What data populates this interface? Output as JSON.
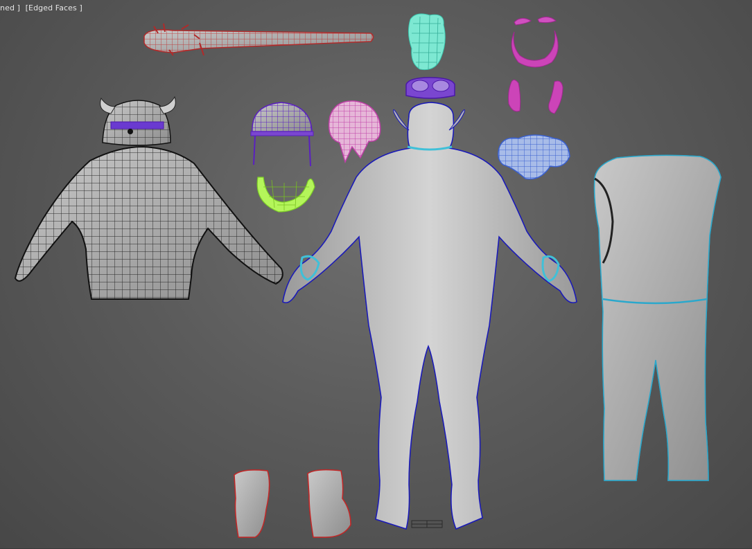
{
  "viewport": {
    "labels": [
      "ned ]",
      "[Edged Faces ]"
    ]
  },
  "objects": [
    {
      "name": "spiked-bat",
      "color": "#d04040"
    },
    {
      "name": "hair-tuft",
      "color": "#6fe0c8"
    },
    {
      "name": "eyebrows",
      "color": "#c43fb0"
    },
    {
      "name": "goggles",
      "color": "#6a2ec8"
    },
    {
      "name": "sideburns",
      "color": "#c43fb0"
    },
    {
      "name": "helmet",
      "color": "#6a2ec8"
    },
    {
      "name": "bandana",
      "color": "#d070b8"
    },
    {
      "name": "beard",
      "color": "#a8f040"
    },
    {
      "name": "loincloth",
      "color": "#4a6fd8"
    },
    {
      "name": "jacket-with-horned-hat",
      "color": "#1a1a1a"
    },
    {
      "name": "troll-body",
      "color": "#2222c8"
    },
    {
      "name": "wristbands",
      "color": "#40c0d8"
    },
    {
      "name": "clothes-vest-pants",
      "color": "#40b8d8"
    },
    {
      "name": "boots",
      "color": "#c83030"
    }
  ],
  "scale_marker": "scale-bar"
}
